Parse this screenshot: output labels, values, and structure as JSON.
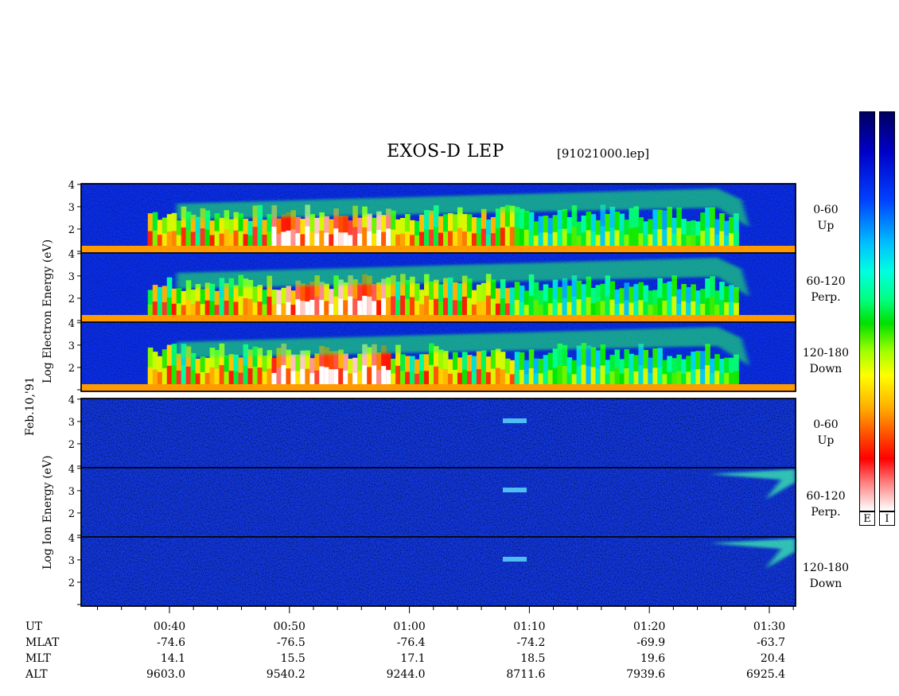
{
  "header": {
    "title": "EXOS-D LEP",
    "file": "[91021000.lep]"
  },
  "left_labels": {
    "electron_axis": "Log   Electron   Energy   (eV)",
    "date": "Feb.10,'91",
    "ion_axis": "Log    Ion   Energy  (eV)"
  },
  "panels": [
    {
      "group": "electron",
      "angle": "0-60",
      "dir": "Up"
    },
    {
      "group": "electron",
      "angle": "60-120",
      "dir": "Perp."
    },
    {
      "group": "electron",
      "angle": "120-180",
      "dir": "Down"
    },
    {
      "group": "ion",
      "angle": "0-60",
      "dir": "Up"
    },
    {
      "group": "ion",
      "angle": "60-120",
      "dir": "Perp."
    },
    {
      "group": "ion",
      "angle": "120-180",
      "dir": "Down"
    }
  ],
  "colorbar": {
    "labels": [
      "E",
      "I"
    ]
  },
  "footer": {
    "row_headers": [
      "UT",
      "MLAT",
      "MLT",
      "ALT"
    ],
    "times": [
      "00:40",
      "00:50",
      "01:00",
      "01:10",
      "01:20",
      "01:30"
    ],
    "mlat": [
      "-74.6",
      "-76.5",
      "-76.4",
      "-74.2",
      "-69.9",
      "-63.7"
    ],
    "mlt": [
      "14.1",
      "15.5",
      "17.1",
      "18.5",
      "19.6",
      "20.4"
    ],
    "alt": [
      "9603.0",
      "9540.2",
      "9244.0",
      "8711.6",
      "7939.6",
      "6925.4"
    ]
  },
  "chart_data": {
    "type": "heatmap",
    "title": "EXOS-D LEP",
    "xlabel": "UT",
    "ylabel": "Log Energy (eV)",
    "x": [
      "00:40",
      "00:50",
      "01:00",
      "01:10",
      "01:20",
      "01:30"
    ],
    "ylim": [
      1,
      4
    ],
    "yticks": [
      2,
      3,
      4
    ],
    "series": [
      {
        "name": "Electron 0-60 Up"
      },
      {
        "name": "Electron 60-120 Perp."
      },
      {
        "name": "Electron 120-180 Down"
      },
      {
        "name": "Ion 0-60 Up"
      },
      {
        "name": "Ion 60-120 Perp."
      },
      {
        "name": "Ion 120-180 Down"
      }
    ]
  }
}
